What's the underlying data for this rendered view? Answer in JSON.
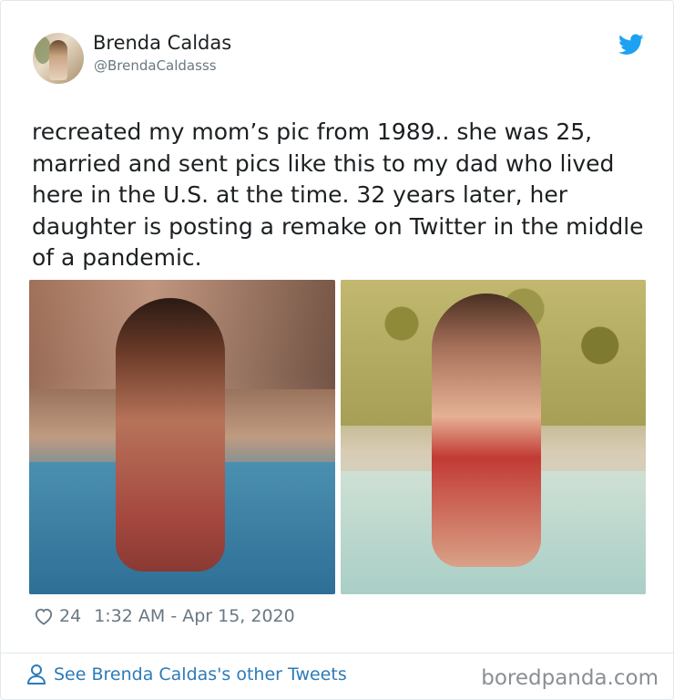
{
  "tweet": {
    "author": {
      "display_name": "Brenda Caldas",
      "handle": "@BrendaCaldasss"
    },
    "text": "recreated my mom’s pic from 1989.. she was 25, married and sent pics like this to my dad who lived here in the U.S. at the time. 32 years later, her daughter is posting a remake on Twitter in the middle of a pandemic.",
    "likes": "24",
    "timestamp": "1:32 AM - Apr 15, 2020"
  },
  "footer": {
    "see_more_label": "See Brenda Caldas's other Tweets",
    "watermark": "boredpanda.com"
  },
  "icons": {
    "brand": "twitter-bird-icon",
    "like": "heart-icon",
    "profile": "person-icon"
  },
  "colors": {
    "twitter_blue": "#1da1f2",
    "link_blue": "#2b7bb9",
    "meta_gray": "#697882"
  }
}
